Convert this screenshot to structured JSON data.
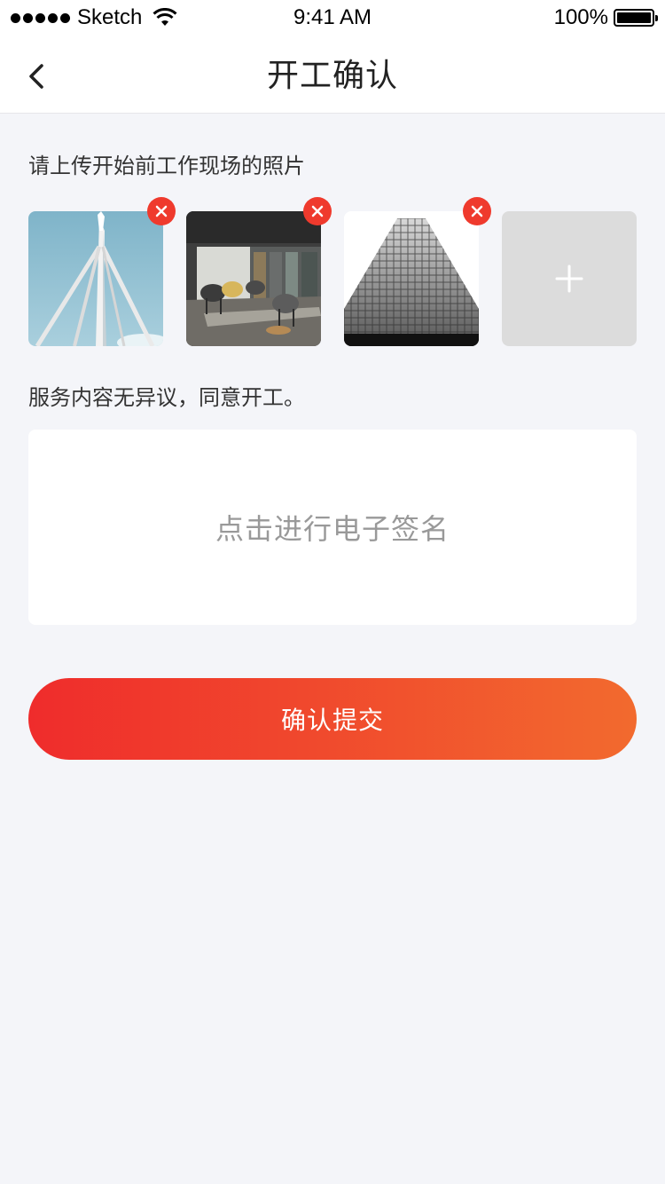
{
  "status_bar": {
    "carrier": "Sketch",
    "time": "9:41 AM",
    "battery": "100%"
  },
  "nav": {
    "title": "开工确认",
    "back_icon": "chevron-left-icon"
  },
  "photos_section": {
    "label": "请上传开始前工作现场的照片",
    "photos": [
      {
        "subject": "tower-mast-photo"
      },
      {
        "subject": "lounge-interior-photo"
      },
      {
        "subject": "skyscraper-facade-photo"
      }
    ],
    "delete_icon": "close-icon",
    "add_icon": "plus-icon"
  },
  "consent": {
    "label": "服务内容无异议，同意开工。"
  },
  "signature": {
    "placeholder": "点击进行电子签名"
  },
  "submit": {
    "label": "确认提交"
  },
  "colors": {
    "accent_start": "#ef2c2c",
    "accent_end": "#f26a2e",
    "delete_red": "#ef3a2d",
    "background": "#f4f5f9"
  }
}
